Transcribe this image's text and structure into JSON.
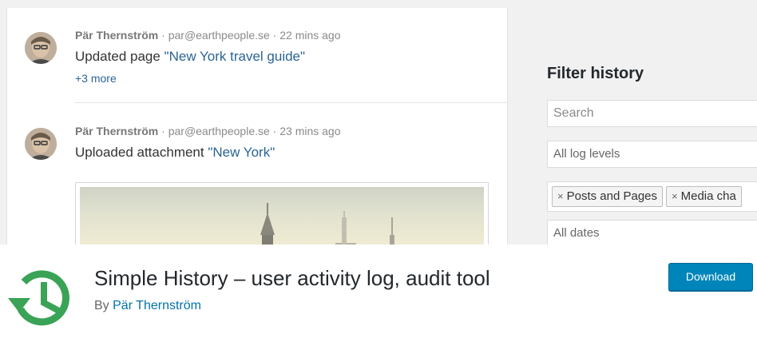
{
  "feed": {
    "entries": [
      {
        "author": "Pär Thernström",
        "email": "par@earthpeople.se",
        "time": "22 mins ago",
        "action_text": "Updated page ",
        "action_link": "\"New York travel guide\"",
        "more": "+3 more"
      },
      {
        "author": "Pär Thernström",
        "email": "par@earthpeople.se",
        "time": "23 mins ago",
        "action_text": "Uploaded attachment ",
        "action_link": "\"New York\""
      }
    ],
    "separator": " · "
  },
  "filter": {
    "title": "Filter history",
    "search_placeholder": "Search",
    "log_levels": "All log levels",
    "tags": [
      "Posts and Pages",
      "Media cha"
    ],
    "tag_remove_glyph": "×",
    "dates": "All dates"
  },
  "plugin": {
    "title": "Simple History – user activity log, audit tool",
    "by_prefix": "By ",
    "author": "Pär Thernström",
    "download_label": "Download",
    "icon": "history-clock-icon",
    "accent_color": "#3aa356",
    "button_color": "#0085ba"
  }
}
